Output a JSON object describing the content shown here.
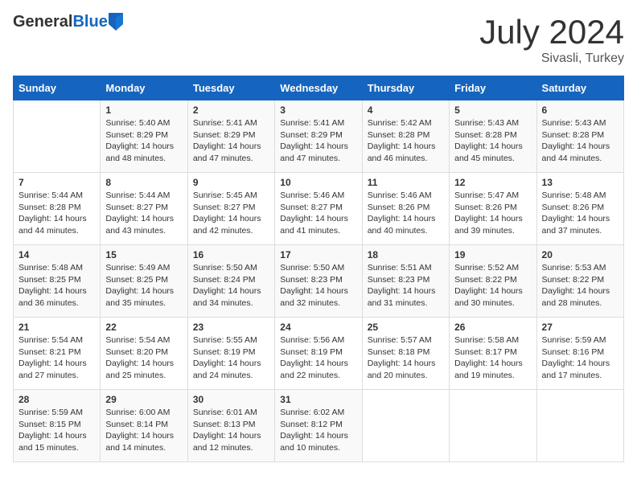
{
  "header": {
    "logo_general": "General",
    "logo_blue": "Blue",
    "month": "July 2024",
    "location": "Sivasli, Turkey"
  },
  "days_of_week": [
    "Sunday",
    "Monday",
    "Tuesday",
    "Wednesday",
    "Thursday",
    "Friday",
    "Saturday"
  ],
  "weeks": [
    [
      {
        "day": "",
        "content": ""
      },
      {
        "day": "1",
        "content": "Sunrise: 5:40 AM\nSunset: 8:29 PM\nDaylight: 14 hours\nand 48 minutes."
      },
      {
        "day": "2",
        "content": "Sunrise: 5:41 AM\nSunset: 8:29 PM\nDaylight: 14 hours\nand 47 minutes."
      },
      {
        "day": "3",
        "content": "Sunrise: 5:41 AM\nSunset: 8:29 PM\nDaylight: 14 hours\nand 47 minutes."
      },
      {
        "day": "4",
        "content": "Sunrise: 5:42 AM\nSunset: 8:28 PM\nDaylight: 14 hours\nand 46 minutes."
      },
      {
        "day": "5",
        "content": "Sunrise: 5:43 AM\nSunset: 8:28 PM\nDaylight: 14 hours\nand 45 minutes."
      },
      {
        "day": "6",
        "content": "Sunrise: 5:43 AM\nSunset: 8:28 PM\nDaylight: 14 hours\nand 44 minutes."
      }
    ],
    [
      {
        "day": "7",
        "content": "Sunrise: 5:44 AM\nSunset: 8:28 PM\nDaylight: 14 hours\nand 44 minutes."
      },
      {
        "day": "8",
        "content": "Sunrise: 5:44 AM\nSunset: 8:27 PM\nDaylight: 14 hours\nand 43 minutes."
      },
      {
        "day": "9",
        "content": "Sunrise: 5:45 AM\nSunset: 8:27 PM\nDaylight: 14 hours\nand 42 minutes."
      },
      {
        "day": "10",
        "content": "Sunrise: 5:46 AM\nSunset: 8:27 PM\nDaylight: 14 hours\nand 41 minutes."
      },
      {
        "day": "11",
        "content": "Sunrise: 5:46 AM\nSunset: 8:26 PM\nDaylight: 14 hours\nand 40 minutes."
      },
      {
        "day": "12",
        "content": "Sunrise: 5:47 AM\nSunset: 8:26 PM\nDaylight: 14 hours\nand 39 minutes."
      },
      {
        "day": "13",
        "content": "Sunrise: 5:48 AM\nSunset: 8:26 PM\nDaylight: 14 hours\nand 37 minutes."
      }
    ],
    [
      {
        "day": "14",
        "content": "Sunrise: 5:48 AM\nSunset: 8:25 PM\nDaylight: 14 hours\nand 36 minutes."
      },
      {
        "day": "15",
        "content": "Sunrise: 5:49 AM\nSunset: 8:25 PM\nDaylight: 14 hours\nand 35 minutes."
      },
      {
        "day": "16",
        "content": "Sunrise: 5:50 AM\nSunset: 8:24 PM\nDaylight: 14 hours\nand 34 minutes."
      },
      {
        "day": "17",
        "content": "Sunrise: 5:50 AM\nSunset: 8:23 PM\nDaylight: 14 hours\nand 32 minutes."
      },
      {
        "day": "18",
        "content": "Sunrise: 5:51 AM\nSunset: 8:23 PM\nDaylight: 14 hours\nand 31 minutes."
      },
      {
        "day": "19",
        "content": "Sunrise: 5:52 AM\nSunset: 8:22 PM\nDaylight: 14 hours\nand 30 minutes."
      },
      {
        "day": "20",
        "content": "Sunrise: 5:53 AM\nSunset: 8:22 PM\nDaylight: 14 hours\nand 28 minutes."
      }
    ],
    [
      {
        "day": "21",
        "content": "Sunrise: 5:54 AM\nSunset: 8:21 PM\nDaylight: 14 hours\nand 27 minutes."
      },
      {
        "day": "22",
        "content": "Sunrise: 5:54 AM\nSunset: 8:20 PM\nDaylight: 14 hours\nand 25 minutes."
      },
      {
        "day": "23",
        "content": "Sunrise: 5:55 AM\nSunset: 8:19 PM\nDaylight: 14 hours\nand 24 minutes."
      },
      {
        "day": "24",
        "content": "Sunrise: 5:56 AM\nSunset: 8:19 PM\nDaylight: 14 hours\nand 22 minutes."
      },
      {
        "day": "25",
        "content": "Sunrise: 5:57 AM\nSunset: 8:18 PM\nDaylight: 14 hours\nand 20 minutes."
      },
      {
        "day": "26",
        "content": "Sunrise: 5:58 AM\nSunset: 8:17 PM\nDaylight: 14 hours\nand 19 minutes."
      },
      {
        "day": "27",
        "content": "Sunrise: 5:59 AM\nSunset: 8:16 PM\nDaylight: 14 hours\nand 17 minutes."
      }
    ],
    [
      {
        "day": "28",
        "content": "Sunrise: 5:59 AM\nSunset: 8:15 PM\nDaylight: 14 hours\nand 15 minutes."
      },
      {
        "day": "29",
        "content": "Sunrise: 6:00 AM\nSunset: 8:14 PM\nDaylight: 14 hours\nand 14 minutes."
      },
      {
        "day": "30",
        "content": "Sunrise: 6:01 AM\nSunset: 8:13 PM\nDaylight: 14 hours\nand 12 minutes."
      },
      {
        "day": "31",
        "content": "Sunrise: 6:02 AM\nSunset: 8:12 PM\nDaylight: 14 hours\nand 10 minutes."
      },
      {
        "day": "",
        "content": ""
      },
      {
        "day": "",
        "content": ""
      },
      {
        "day": "",
        "content": ""
      }
    ]
  ]
}
